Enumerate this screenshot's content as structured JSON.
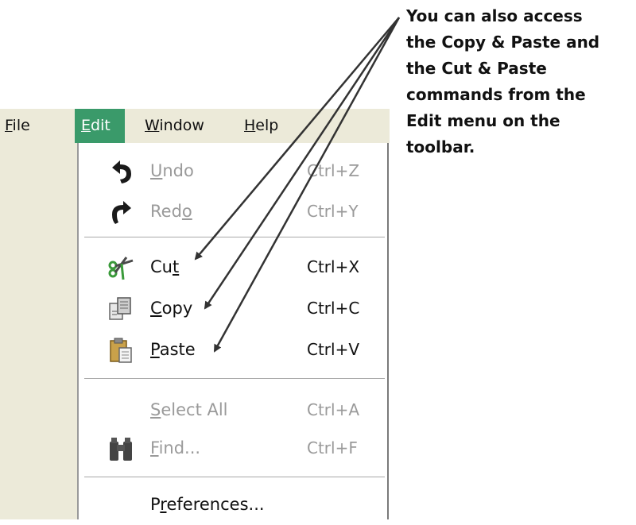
{
  "menubar": {
    "items": [
      {
        "pre": "",
        "key": "F",
        "post": "ile"
      },
      {
        "pre": "",
        "key": "E",
        "post": "dit"
      },
      {
        "pre": "",
        "key": "W",
        "post": "indow"
      },
      {
        "pre": "",
        "key": "H",
        "post": "elp"
      }
    ],
    "active": "Edit",
    "active_color": "#3a9a6a"
  },
  "edit_menu": {
    "items": [
      {
        "icon": "undo-icon",
        "pre": "",
        "key": "U",
        "post": "ndo",
        "shortcut": "Ctrl+Z",
        "enabled": false
      },
      {
        "icon": "redo-icon",
        "pre": "Red",
        "key": "o",
        "post": "",
        "shortcut": "Ctrl+Y",
        "enabled": false
      },
      {
        "icon": "scissors-icon",
        "pre": "Cu",
        "key": "t",
        "post": "",
        "shortcut": "Ctrl+X",
        "enabled": true
      },
      {
        "icon": "copy-icon",
        "pre": "",
        "key": "C",
        "post": "opy",
        "shortcut": "Ctrl+C",
        "enabled": true
      },
      {
        "icon": "paste-icon",
        "pre": "",
        "key": "P",
        "post": "aste",
        "shortcut": "Ctrl+V",
        "enabled": true
      },
      {
        "icon": "",
        "pre": "",
        "key": "S",
        "post": "elect All",
        "shortcut": "Ctrl+A",
        "enabled": false
      },
      {
        "icon": "binoculars-icon",
        "pre": "",
        "key": "F",
        "post": "ind...",
        "shortcut": "Ctrl+F",
        "enabled": false
      },
      {
        "icon": "",
        "pre": "P",
        "key": "r",
        "post": "eferences...",
        "shortcut": "",
        "enabled": true
      }
    ]
  },
  "callout": {
    "lines": [
      "You can also access",
      "the Copy & Paste and",
      "the Cut & Paste",
      "commands from the",
      "Edit menu on the",
      "toolbar."
    ]
  },
  "colors": {
    "menubar_bg": "#ecead9",
    "disabled_text": "#9a9a9a",
    "arrow": "#333333",
    "scissors_handle": "#3a9a3a",
    "paste_clipboard": "#c9a14a"
  }
}
